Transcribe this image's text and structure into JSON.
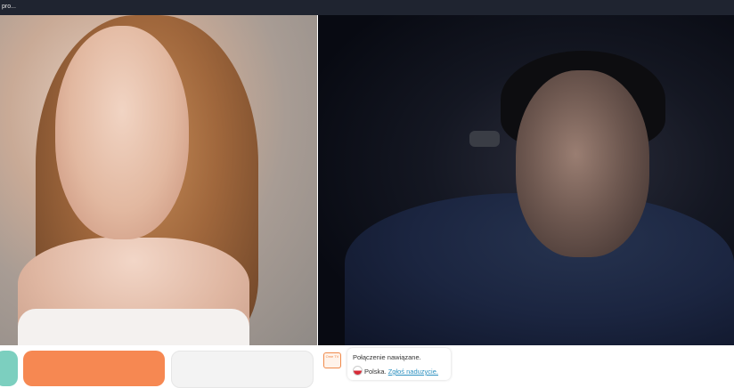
{
  "titlebar": {
    "tab_text": "pro..."
  },
  "chat": {
    "avatar_label": "Ome TV",
    "connection_message": "Połączenie nawiązane.",
    "country": "Polska.",
    "report_link": "Zgłoś naduzycie."
  },
  "colors": {
    "accent_orange": "#f68852",
    "accent_teal": "#7ccfbf",
    "link_blue": "#2a8fbf"
  }
}
